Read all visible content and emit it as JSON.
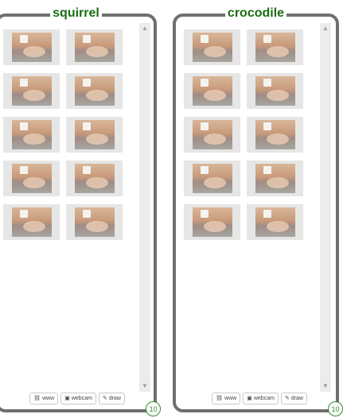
{
  "panels": [
    {
      "title": "squirrel",
      "count": "10",
      "thumbnails": 10
    },
    {
      "title": "crocodile",
      "count": "10",
      "thumbnails": 10
    }
  ],
  "buttons": {
    "www": "www",
    "webcam": "webcam",
    "draw": "draw"
  },
  "icons": {
    "www": "link-icon",
    "webcam": "camera-icon",
    "draw": "pencil-icon"
  },
  "colors": {
    "title": "#1b6e12",
    "border": "#6f6f6f",
    "badge": "#2f8a29"
  }
}
